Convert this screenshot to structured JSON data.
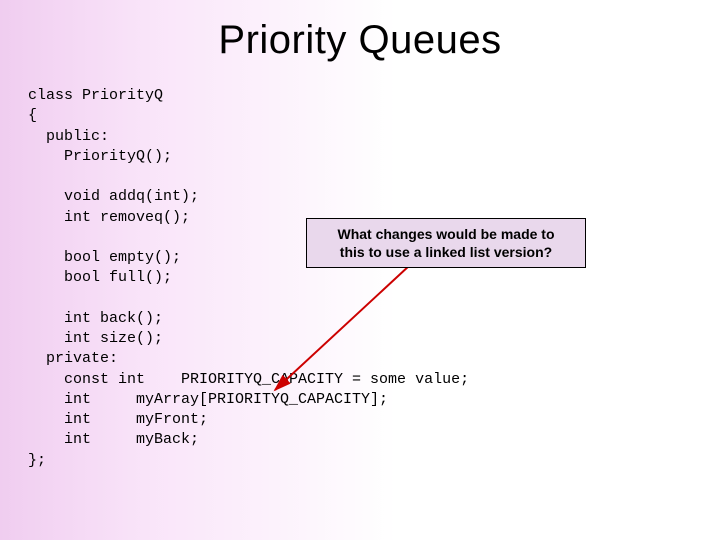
{
  "title": "Priority Queues",
  "callout": {
    "line1": "What changes would be made to",
    "line2": "this to use a linked list version?"
  },
  "code": {
    "l01": "class PriorityQ",
    "l02": "{",
    "l03": "  public:",
    "l04": "    PriorityQ();",
    "l05": "",
    "l06": "    void addq(int);",
    "l07": "    int removeq();",
    "l08": "",
    "l09": "    bool empty();",
    "l10": "    bool full();",
    "l11": "",
    "l12": "    int back();",
    "l13": "    int size();",
    "l14": "  private:",
    "l15": "    const int    PRIORITYQ_CAPACITY = some value;",
    "l16": "    int     myArray[PRIORITYQ_CAPACITY];",
    "l17": "    int     myFront;",
    "l18": "    int     myBack;",
    "l19": "};"
  }
}
